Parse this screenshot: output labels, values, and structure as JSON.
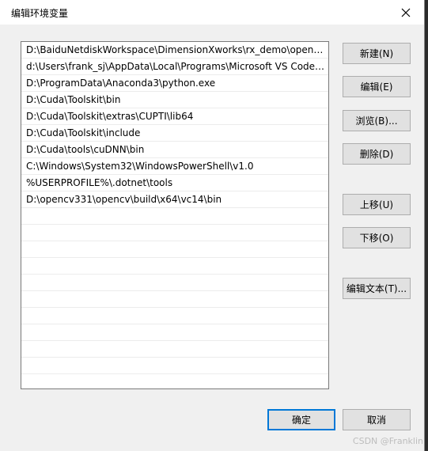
{
  "window": {
    "title": "编辑环境变量"
  },
  "entries": [
    "D:\\BaiduNetdiskWorkspace\\DimensionXworks\\rx_demo\\opens...",
    "d:\\Users\\frank_sj\\AppData\\Local\\Programs\\Microsoft VS Code\\...",
    "D:\\ProgramData\\Anaconda3\\python.exe",
    "D:\\Cuda\\Toolskit\\bin",
    "D:\\Cuda\\Toolskit\\extras\\CUPTI\\lib64",
    "D:\\Cuda\\Toolskit\\include",
    "D:\\Cuda\\tools\\cuDNN\\bin",
    "C:\\Windows\\System32\\WindowsPowerShell\\v1.0",
    "%USERPROFILE%\\.dotnet\\tools",
    "D:\\opencv331\\opencv\\build\\x64\\vc14\\bin",
    "",
    "",
    "",
    "",
    "",
    "",
    "",
    "",
    "",
    "",
    ""
  ],
  "buttons": {
    "new": "新建(N)",
    "edit": "编辑(E)",
    "browse": "浏览(B)...",
    "delete": "删除(D)",
    "move_up": "上移(U)",
    "move_down": "下移(O)",
    "edit_text": "编辑文本(T)...",
    "ok": "确定",
    "cancel": "取消"
  },
  "watermark": "CSDN @Franklin"
}
